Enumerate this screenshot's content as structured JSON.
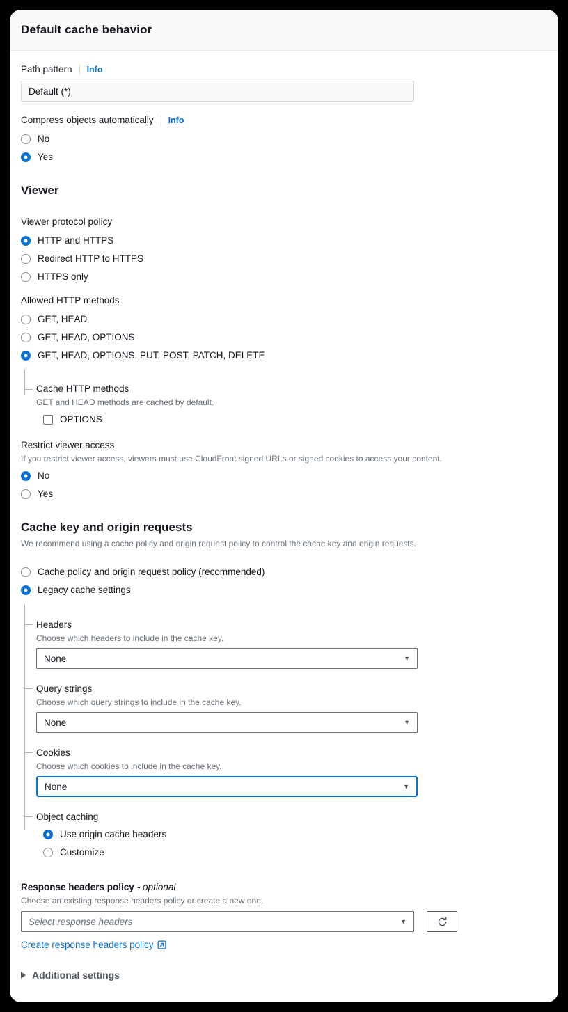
{
  "header": {
    "title": "Default cache behavior"
  },
  "path_pattern": {
    "label": "Path pattern",
    "info": "Info",
    "value": "Default (*)"
  },
  "compress": {
    "label": "Compress objects automatically",
    "info": "Info",
    "options": [
      "No",
      "Yes"
    ],
    "selected": "Yes"
  },
  "viewer": {
    "title": "Viewer",
    "protocol_policy": {
      "label": "Viewer protocol policy",
      "options": [
        "HTTP and HTTPS",
        "Redirect HTTP to HTTPS",
        "HTTPS only"
      ],
      "selected": "HTTP and HTTPS"
    },
    "allowed_methods": {
      "label": "Allowed HTTP methods",
      "options": [
        "GET, HEAD",
        "GET, HEAD, OPTIONS",
        "GET, HEAD, OPTIONS, PUT, POST, PATCH, DELETE"
      ],
      "selected": "GET, HEAD, OPTIONS, PUT, POST, PATCH, DELETE"
    },
    "cache_http_methods": {
      "label": "Cache HTTP methods",
      "description": "GET and HEAD methods are cached by default.",
      "checkbox_label": "OPTIONS",
      "checked": false
    },
    "restrict_viewer_access": {
      "label": "Restrict viewer access",
      "description": "If you restrict viewer access, viewers must use CloudFront signed URLs or signed cookies to access your content.",
      "options": [
        "No",
        "Yes"
      ],
      "selected": "No"
    }
  },
  "cache_key": {
    "title": "Cache key and origin requests",
    "description": "We recommend using a cache policy and origin request policy to control the cache key and origin requests.",
    "options": [
      "Cache policy and origin request policy (recommended)",
      "Legacy cache settings"
    ],
    "selected": "Legacy cache settings",
    "headers": {
      "label": "Headers",
      "description": "Choose which headers to include in the cache key.",
      "value": "None"
    },
    "query_strings": {
      "label": "Query strings",
      "description": "Choose which query strings to include in the cache key.",
      "value": "None"
    },
    "cookies": {
      "label": "Cookies",
      "description": "Choose which cookies to include in the cache key.",
      "value": "None"
    },
    "object_caching": {
      "label": "Object caching",
      "options": [
        "Use origin cache headers",
        "Customize"
      ],
      "selected": "Use origin cache headers"
    }
  },
  "response_headers_policy": {
    "label": "Response headers policy",
    "optional_suffix": "- optional",
    "description": "Choose an existing response headers policy or create a new one.",
    "placeholder": "Select response headers",
    "create_link": "Create response headers policy",
    "refresh_icon": "refresh-icon",
    "external_link_icon": "external-link-icon"
  },
  "additional_settings": {
    "label": "Additional settings",
    "expanded": false
  },
  "colors": {
    "accent": "#0972d3",
    "text": "#16191f",
    "muted": "#687078",
    "border": "#d5dbdb"
  }
}
